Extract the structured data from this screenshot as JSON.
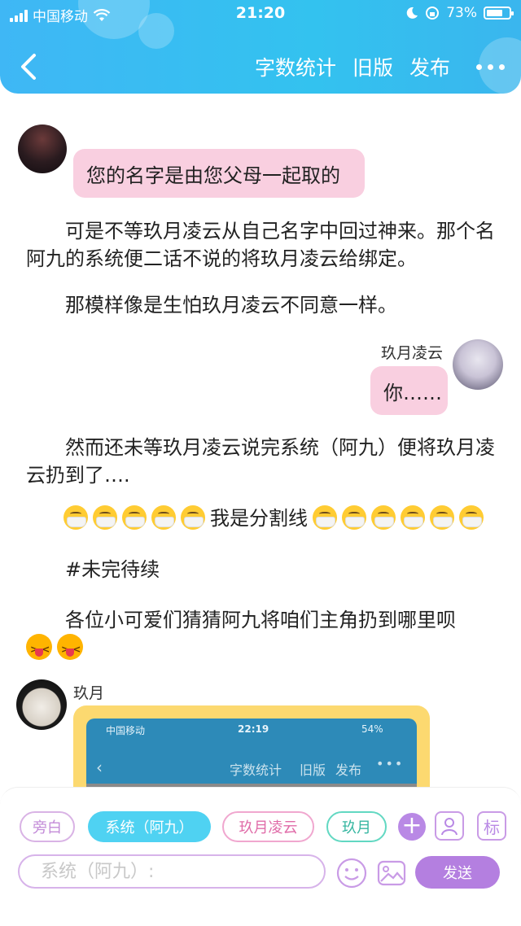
{
  "status_bar": {
    "carrier": "中国移动",
    "time": "21:20",
    "battery_percent": "73%",
    "battery_level": 0.73
  },
  "nav": {
    "word_count": "字数统计",
    "old_version": "旧版",
    "publish": "发布"
  },
  "messages": {
    "first_bubble": "您的名字是由您父母一起取的",
    "para1": "　　可是不等玖月凌云从自己名字中回过神来。那个名阿九的系统便二话不说的将玖月凌云给绑定。",
    "para2": "　　那模样像是生怕玖月凌云不同意一样。",
    "right_name": "玖月凌云",
    "right_bubble": "你……",
    "para3": "　　然而还未等玖月凌云说完系统（阿九）便将玖月凌云扔到了….",
    "divider_text": "我是分割线",
    "para4": "　　#未完待续",
    "para5": "　　各位小可爱们猜猜阿九将咱们主角扔到哪里呗",
    "bottom_name": "玖月"
  },
  "screenshot_card": {
    "carrier": "中国移动",
    "time": "22:19",
    "battery": "54%",
    "word_count": "字数统计",
    "old_version": "旧版",
    "publish": "发布"
  },
  "bottom_bar": {
    "roles": [
      "旁白",
      "系统（阿九）",
      "玖月凌云",
      "玖月"
    ],
    "tag_icon_text": "标",
    "input_placeholder": "系统（阿九）:",
    "send_label": "发送"
  },
  "colors": {
    "header": "#3fb7f5",
    "pink_bubble": "#f9cfe0",
    "send": "#b47fe0",
    "active_role": "#4fd2f2"
  }
}
